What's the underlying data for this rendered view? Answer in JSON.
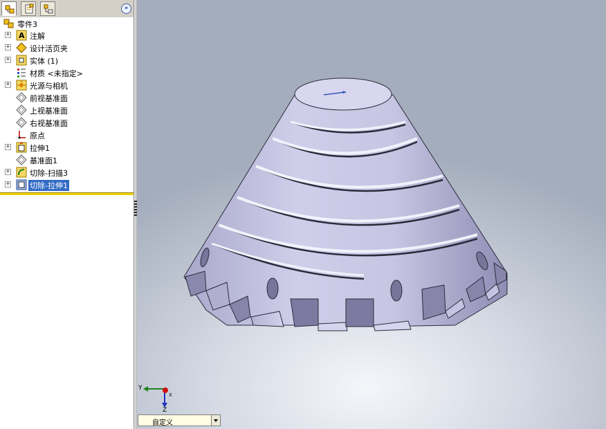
{
  "tree": {
    "root": "零件3",
    "items": [
      {
        "label": "注解",
        "icon": "annotation-icon",
        "expandable": true
      },
      {
        "label": "设计活页夹",
        "icon": "design-binder-icon",
        "expandable": true
      },
      {
        "label": "实体 (1)",
        "icon": "solid-bodies-icon",
        "expandable": true
      },
      {
        "label": "材质 <未指定>",
        "icon": "material-icon",
        "expandable": false
      },
      {
        "label": "光源与相机",
        "icon": "lights-cameras-icon",
        "expandable": true
      },
      {
        "label": "前视基准面",
        "icon": "plane-icon",
        "expandable": false
      },
      {
        "label": "上视基准面",
        "icon": "plane-icon",
        "expandable": false
      },
      {
        "label": "右视基准面",
        "icon": "plane-icon",
        "expandable": false
      },
      {
        "label": "原点",
        "icon": "origin-icon",
        "expandable": false
      },
      {
        "label": "拉伸1",
        "icon": "extrude-icon",
        "expandable": true
      },
      {
        "label": "基准面1",
        "icon": "plane-icon",
        "expandable": false
      },
      {
        "label": "切除-扫描3",
        "icon": "cut-sweep-icon",
        "expandable": true
      },
      {
        "label": "切除-拉伸1",
        "icon": "cut-extrude-icon",
        "expandable": true,
        "selected": true
      }
    ]
  },
  "triad": {
    "y": "Y",
    "z": "Z",
    "x": "X"
  },
  "view_orientation": {
    "value": "自定义"
  },
  "colors": {
    "selection": "#316ac5",
    "rollback": "#f0d000",
    "model": "#c7c6e3"
  }
}
